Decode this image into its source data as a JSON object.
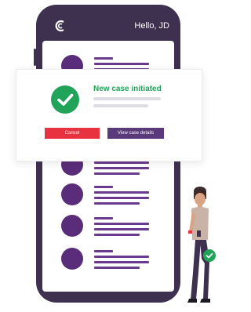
{
  "phone": {
    "greeting": "Hello, JD",
    "logo_icon": "c-brand-logo-icon",
    "list_rows": 7
  },
  "notice": {
    "title": "New case initiated",
    "icon": "check-circle-icon",
    "cancel_label": "Cancel",
    "view_label": "View case details"
  },
  "colors": {
    "phone_frame": "#3e3150",
    "avatar": "#5a2d7a",
    "text_line": "#6b3a8e",
    "success": "#22a35a",
    "cancel": "#e8323f",
    "primary": "#5a3a7a"
  },
  "person": {
    "badge_icon": "check-badge-icon"
  }
}
